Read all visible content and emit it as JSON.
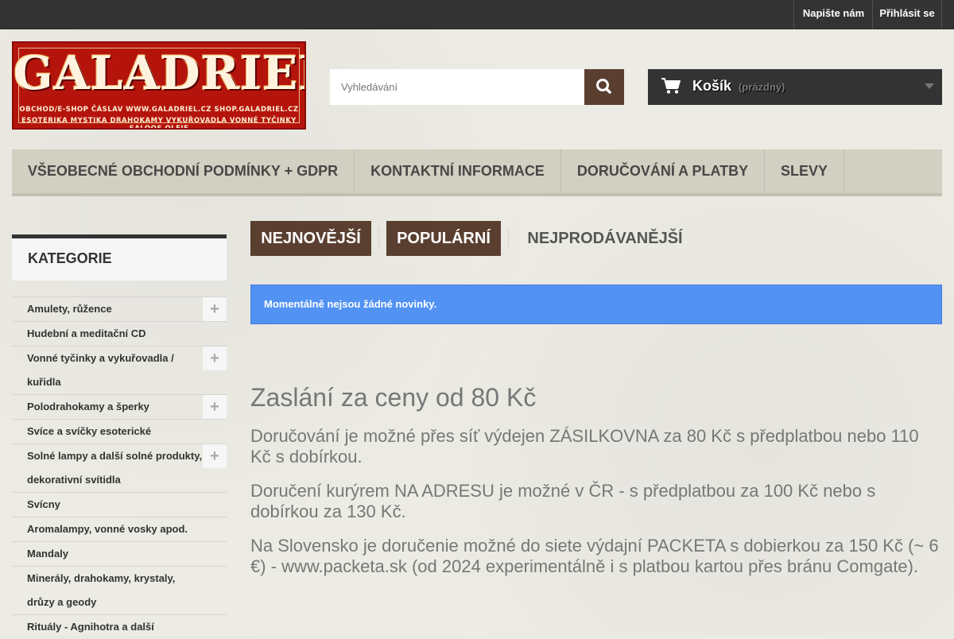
{
  "topbar": {
    "contact_label": "Napište nám",
    "login_label": "Přihlásit se"
  },
  "logo": {
    "word": "GALADRIEL",
    "line1": "OBCHOD/E-SHOP ČÁSLAV  WWW.GALADRIEL.CZ  SHOP.GALADRIEL.CZ",
    "line2": "ESOTERIKA MYSTIKA  DRAHOKAMY VYKUŘOVADLA  VONNÉ TYČINKY SALOOS OLEJE"
  },
  "search": {
    "placeholder": "Vyhledávání",
    "icon": "search-icon"
  },
  "cart": {
    "title": "Košík",
    "state": "(prázdný)",
    "icon": "shopping-cart-icon"
  },
  "menu": {
    "items": [
      {
        "label": "VŠEOBECNÉ OBCHODNÍ PODMÍNKY + GDPR"
      },
      {
        "label": "KONTAKTNÍ INFORMACE"
      },
      {
        "label": "DORUČOVÁNÍ A PLATBY"
      },
      {
        "label": "SLEVY"
      }
    ]
  },
  "sidebar": {
    "title": "KATEGORIE",
    "items": [
      {
        "label": "Amulety, růžence",
        "expandable": true
      },
      {
        "label": "Hudební a meditační CD",
        "expandable": false
      },
      {
        "label": "Vonné tyčinky a vykuřovadla / kuřidla",
        "expandable": true
      },
      {
        "label": "Polodrahokamy a šperky",
        "expandable": true
      },
      {
        "label": "Svíce a svíčky esoterické",
        "expandable": false
      },
      {
        "label": "Solné lampy a další solné produkty, dekorativní svítidla",
        "expandable": true
      },
      {
        "label": "Svícny",
        "expandable": false
      },
      {
        "label": "Aromalampy, vonné vosky apod.",
        "expandable": false
      },
      {
        "label": "Mandaly",
        "expandable": false
      },
      {
        "label": "Minerály, drahokamy, krystaly, drůzy a geody",
        "expandable": false
      },
      {
        "label": "Rituály - Agnihotra a další",
        "expandable": false
      }
    ]
  },
  "tabs": [
    {
      "label": "NEJNOVĚJŠÍ",
      "active": true
    },
    {
      "label": "POPULÁRNÍ",
      "active": true
    },
    {
      "label": "NEJPRODÁVANĚJŠÍ",
      "active": false
    }
  ],
  "alert": {
    "text": "Momentálně nejsou žádné novinky."
  },
  "content": {
    "heading": "Zaslání za ceny od 80 Kč",
    "paragraphs": [
      "Doručování je možné přes síť výdejen ZÁSILKOVNA za 80 Kč s předplatbou nebo 110 Kč s dobírkou.",
      "Doručení kurýrem NA ADRESU je možné v ČR - s předplatbou za 100 Kč nebo s dobírkou za 130 Kč.",
      "Na Slovensko je doručenie možné do siete výdajní PACKETA s dobierkou za 150 Kč (~ 6 €) - www.packeta.sk (od 2024 experimentálně i s platbou kartou přes bránu Comgate)."
    ]
  },
  "colors": {
    "accent_brown": "#5a3f30",
    "dark_bar": "#333333",
    "alert_blue": "#5192f3",
    "menu_bg": "#d1d0c2"
  }
}
